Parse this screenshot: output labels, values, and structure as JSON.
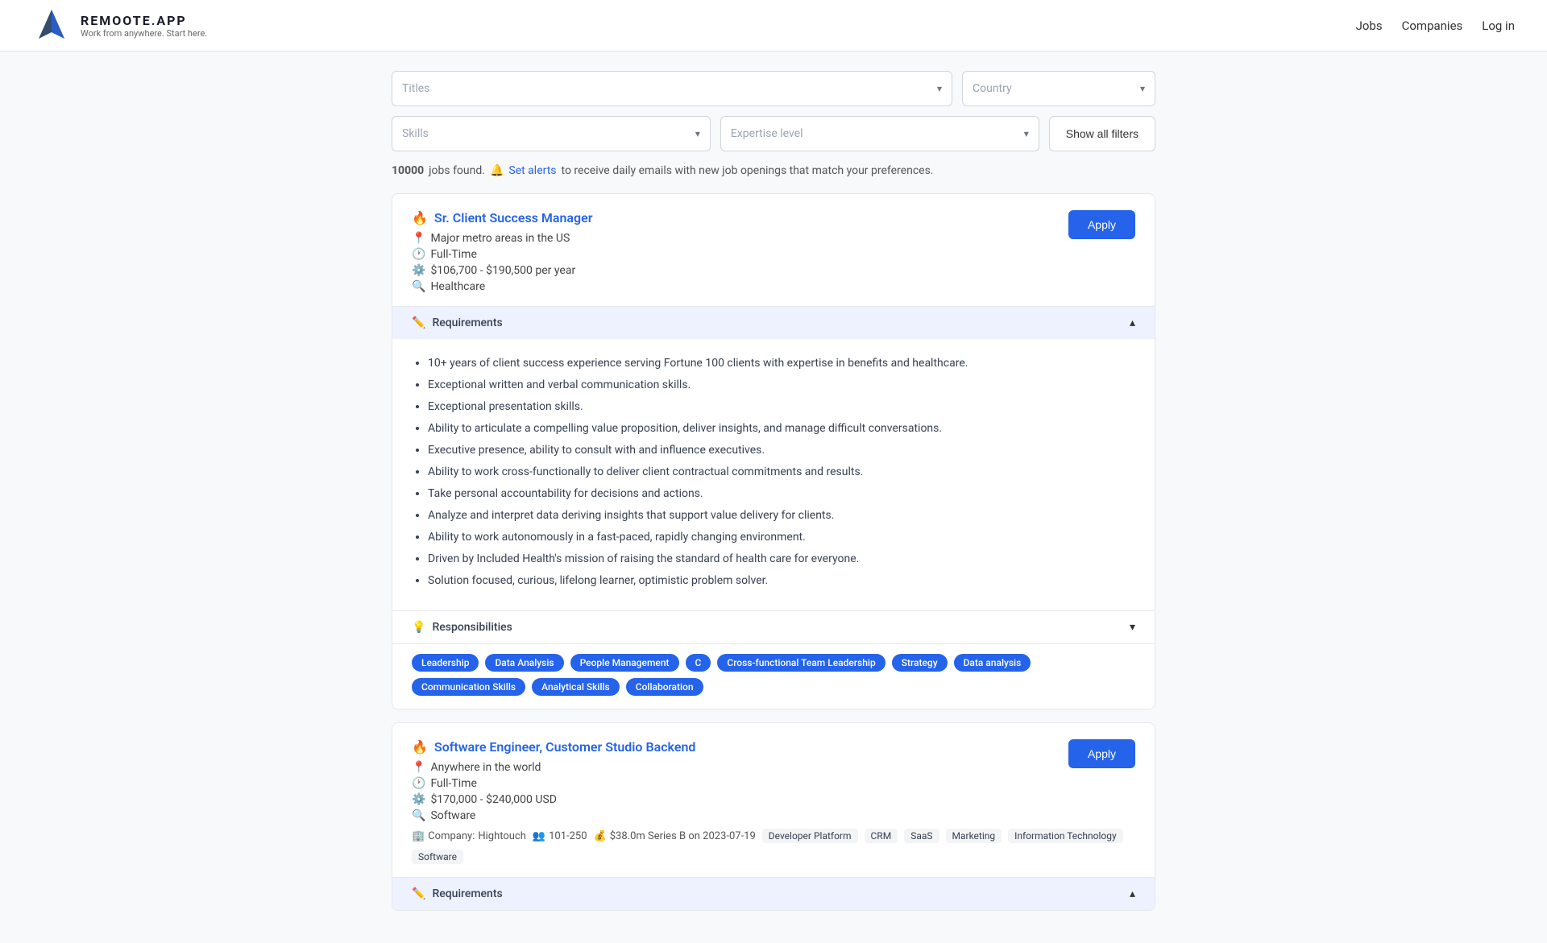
{
  "nav": {
    "logo_title": "REMOOTE.APP",
    "logo_subtitle": "Work from anywhere. Start here.",
    "links": [
      "Jobs",
      "Companies",
      "Log in"
    ]
  },
  "filters": {
    "titles_placeholder": "Titles",
    "country_placeholder": "Country",
    "skills_placeholder": "Skills",
    "expertise_placeholder": "Expertise level",
    "show_all_label": "Show all filters"
  },
  "results": {
    "count": "10000",
    "count_label": "jobs found.",
    "alerts_label": "Set alerts",
    "alerts_suffix": "to receive daily emails with new job openings that match your preferences."
  },
  "jobs": [
    {
      "id": 1,
      "title": "Sr. Client Success Manager",
      "location": "Major metro areas in the US",
      "type": "Full-Time",
      "salary": "$106,700 - $190,500 per year",
      "category": "Healthcare",
      "apply_label": "Apply",
      "requirements_label": "Requirements",
      "requirements": [
        "10+ years of client success experience serving Fortune 100 clients with expertise in benefits and healthcare.",
        "Exceptional written and verbal communication skills.",
        "Exceptional presentation skills.",
        "Ability to articulate a compelling value proposition, deliver insights, and manage difficult conversations.",
        "Executive presence, ability to consult with and influence executives.",
        "Ability to work cross-functionally to deliver client contractual commitments and results.",
        "Take personal accountability for decisions and actions.",
        "Analyze and interpret data deriving insights that support value delivery for clients.",
        "Ability to work autonomously in a fast-paced, rapidly changing environment.",
        "Driven by Included Health's mission of raising the standard of health care for everyone.",
        "Solution focused, curious, lifelong learner, optimistic problem solver."
      ],
      "responsibilities_label": "Responsibilities",
      "tags": [
        "Leadership",
        "Data Analysis",
        "People Management",
        "C",
        "Cross-functional Team Leadership",
        "Strategy",
        "Data analysis",
        "Communication Skills",
        "Analytical Skills",
        "Collaboration"
      ]
    },
    {
      "id": 2,
      "title": "Software Engineer, Customer Studio Backend",
      "location": "Anywhere in the world",
      "type": "Full-Time",
      "salary": "$170,000 - $240,000 USD",
      "category": "Software",
      "company_name": "Hightouch",
      "company_size": "101-250",
      "funding": "$38.0m Series B on 2023-07-19",
      "apply_label": "Apply",
      "requirements_label": "Requirements",
      "company_tags": [
        "Developer Platform",
        "CRM",
        "SaaS",
        "Marketing",
        "Information Technology",
        "Software"
      ]
    }
  ]
}
